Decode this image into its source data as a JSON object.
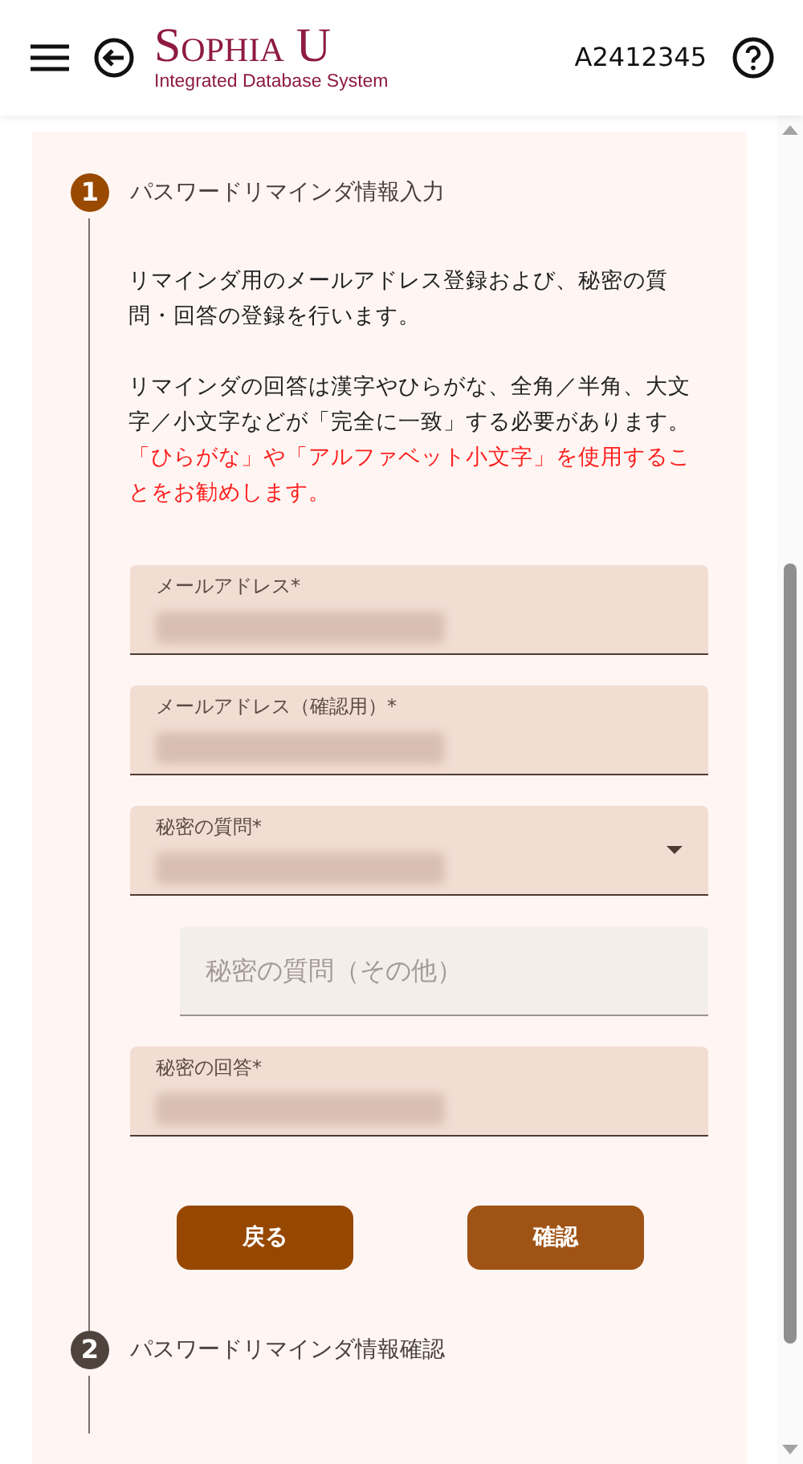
{
  "header": {
    "logo_title": "Sophia U",
    "logo_subtitle": "Integrated Database System",
    "user_id": "A2412345"
  },
  "steps": [
    {
      "number": "1",
      "title": "パスワードリマインダ情報入力",
      "selected": true,
      "paragraphs": [
        {
          "text": "リマインダ用のメールアドレス登録および、秘密の質問・回答の登録を行います。"
        },
        {
          "text": "リマインダの回答は漢字やひらがな、全角／半角、大文字／小文字などが「完全に一致」する必要があります。",
          "warning": "「ひらがな」や「アルファベット小文字」を使用することをお勧めします。"
        }
      ],
      "fields": [
        {
          "kind": "text",
          "label": "メールアドレス*"
        },
        {
          "kind": "text",
          "label": "メールアドレス（確認用）*"
        },
        {
          "kind": "select",
          "label": "秘密の質問*"
        },
        {
          "kind": "plain",
          "placeholder": "秘密の質問（その他）"
        },
        {
          "kind": "text",
          "label": "秘密の回答*"
        }
      ],
      "buttons": [
        {
          "label": "戻る",
          "kind": "back"
        },
        {
          "label": "確認",
          "kind": "confirm"
        }
      ]
    },
    {
      "number": "2",
      "title": "パスワードリマインダ情報確認",
      "selected": false
    }
  ]
}
